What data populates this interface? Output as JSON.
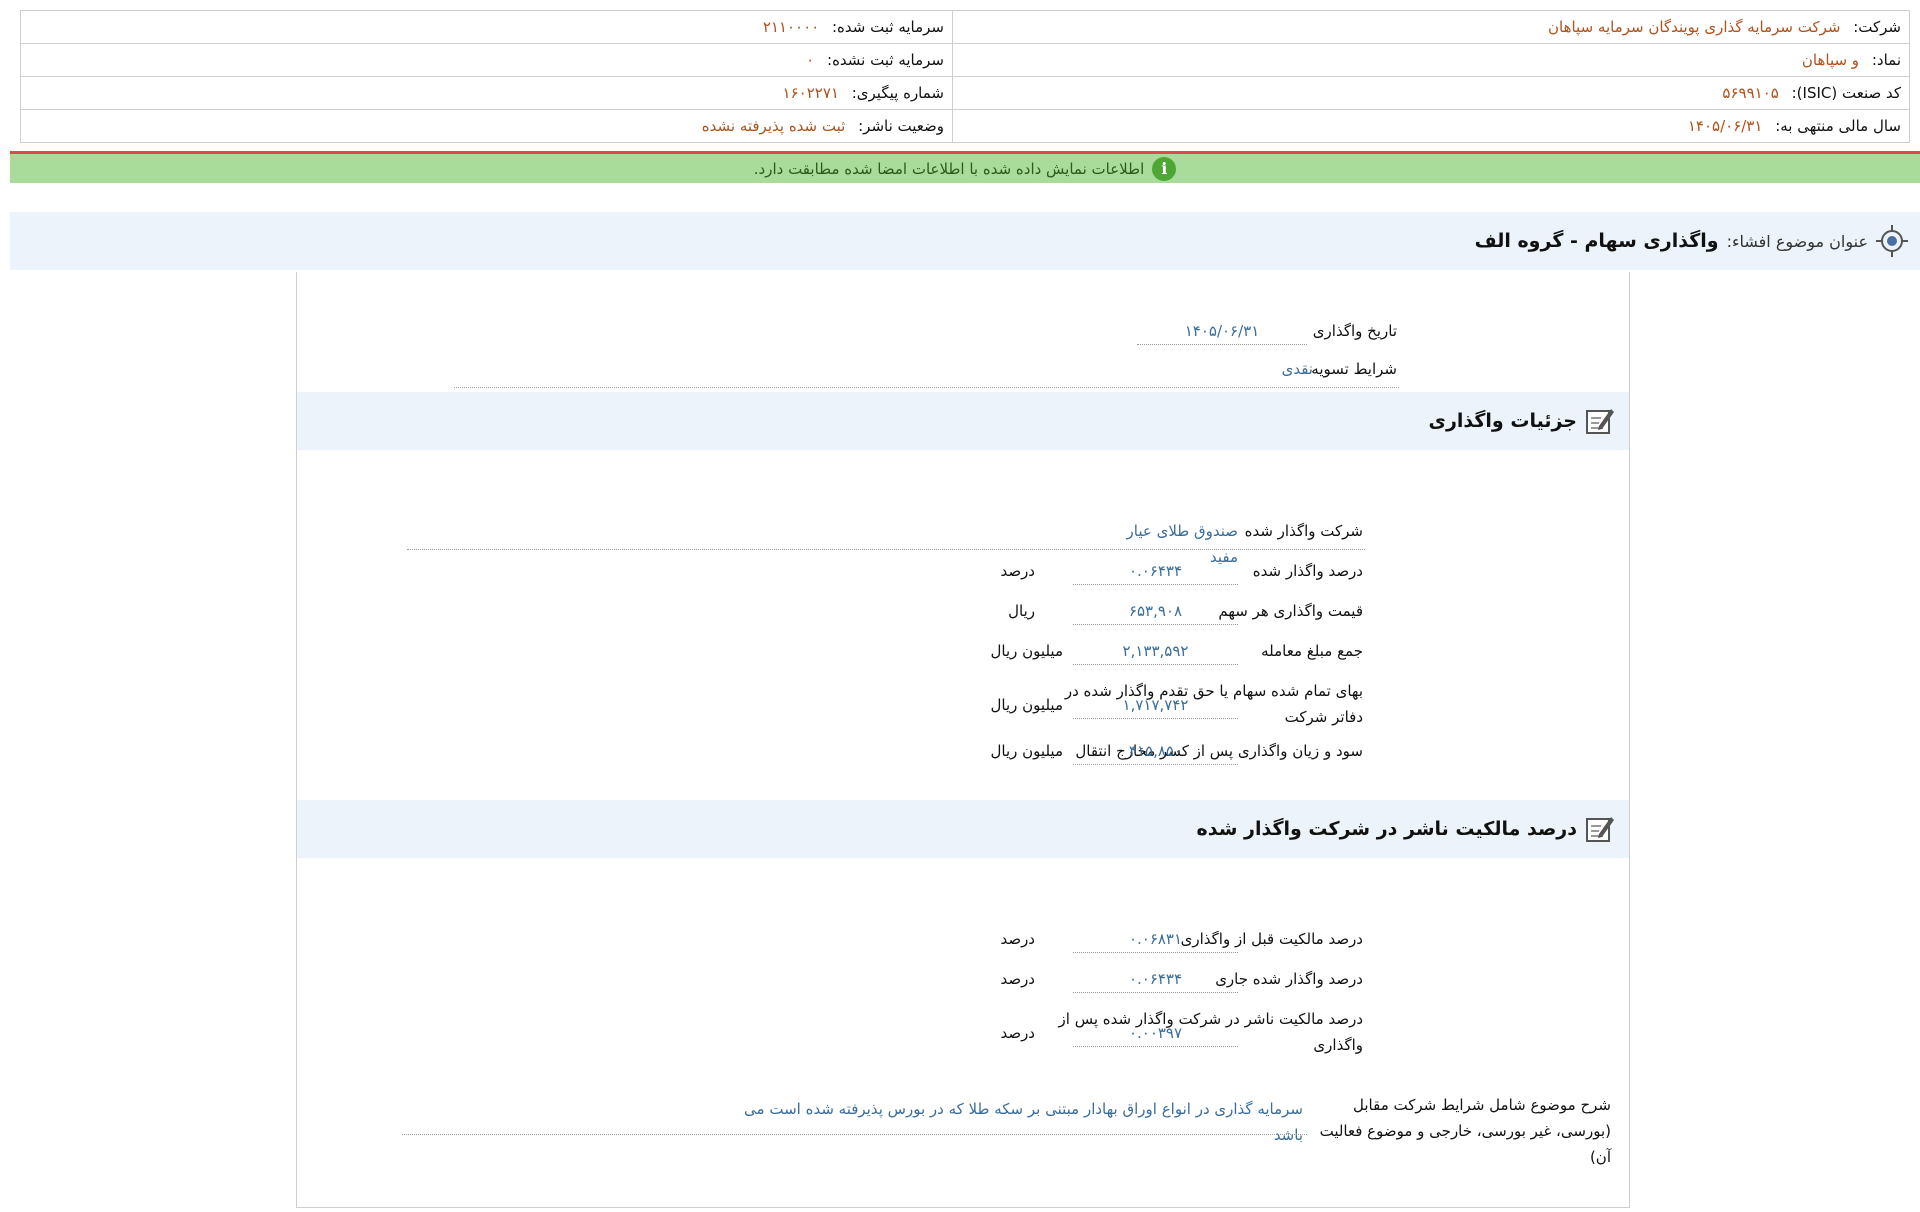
{
  "header": {
    "company_label": "شرکت:",
    "company_value": "شرکت سرمایه گذاری پویندگان سرمایه سپاهان",
    "registered_capital_label": "سرمایه ثبت شده:",
    "registered_capital_value": "۲۱۱۰۰۰۰",
    "symbol_label": "نماد:",
    "symbol_value": "و سپاهان",
    "unregistered_capital_label": "سرمایه ثبت نشده:",
    "unregistered_capital_value": "۰",
    "isic_label": "کد صنعت (ISIC):",
    "isic_value": "۵۶۹۹۱۰۵",
    "tracking_label": "شماره پیگیری:",
    "tracking_value": "۱۶۰۲۲۷۱",
    "fiscal_year_label": "سال مالی منتهی به:",
    "fiscal_year_value": "۱۴۰۵/۰۶/۳۱",
    "publisher_status_label": "وضعیت ناشر:",
    "publisher_status_value": "ثبت شده پذیرفته نشده"
  },
  "alert": {
    "text": "اطلاعات نمایش داده شده با اطلاعات امضا شده مطابقت دارد.",
    "icon": "info-icon",
    "color_bg": "#a9dc9b",
    "color_border": "#e0484d"
  },
  "topic": {
    "label": "عنوان موضوع افشاء:",
    "title": "واگذاری سهام - گروه الف"
  },
  "general": {
    "transfer_date_label": "تاریخ واگذاری",
    "transfer_date_value": "۱۴۰۵/۰۶/۳۱",
    "settlement_label": "شرایط تسویه",
    "settlement_value": "نقدی"
  },
  "details": {
    "title": "جزئیات واگذاری",
    "company_label": "شرکت واگذار شده",
    "company_value": "صندوق طلای عیار مفید",
    "percent_label": "درصد واگذار شده",
    "percent_value": "۰.۰۶۴۳۴",
    "percent_unit": "درصد",
    "price_label": "قیمت واگذاری هر سهم",
    "price_value": "۶۵۳,۹۰۸",
    "price_unit": "ریال",
    "total_label": "جمع مبلغ معامله",
    "total_value": "۲,۱۳۳,۵۹۲",
    "total_unit": "میلیون ریال",
    "book_value_label": "بهای تمام شده سهام یا حق تقدم واگذار شده در دفاتر شرکت",
    "book_value_value": "۱,۷۱۷,۷۴۲",
    "book_value_unit": "میلیون ریال",
    "profit_label": "سود و زیان واگذاری پس از کسر مخارج انتقال",
    "profit_value": "۴۱۵,۸۵۰",
    "profit_unit": "میلیون ریال"
  },
  "ownership": {
    "title": "درصد مالکیت ناشر در شرکت واگذار شده",
    "before_label": "درصد مالکیت قبل از واگذاری",
    "before_value": "۰.۰۶۸۳۱",
    "before_unit": "درصد",
    "current_label": "درصد واگذار شده جاری",
    "current_value": "۰.۰۶۴۳۴",
    "current_unit": "درصد",
    "after_label": "درصد مالکیت ناشر در شرکت واگذار شده پس از واگذاری",
    "after_value": "۰.۰۰۳۹۷",
    "after_unit": "درصد",
    "description_label": "شرح موضوع شامل شرایط شرکت مقابل (بورسی، غیر بورسی، خارجی و موضوع فعالیت آن)",
    "description_value": "سرمایه گذاری در انواع اوراق بهادار مبتنی بر سکه طلا که در بورس پذیرفته شده است می باشد"
  }
}
